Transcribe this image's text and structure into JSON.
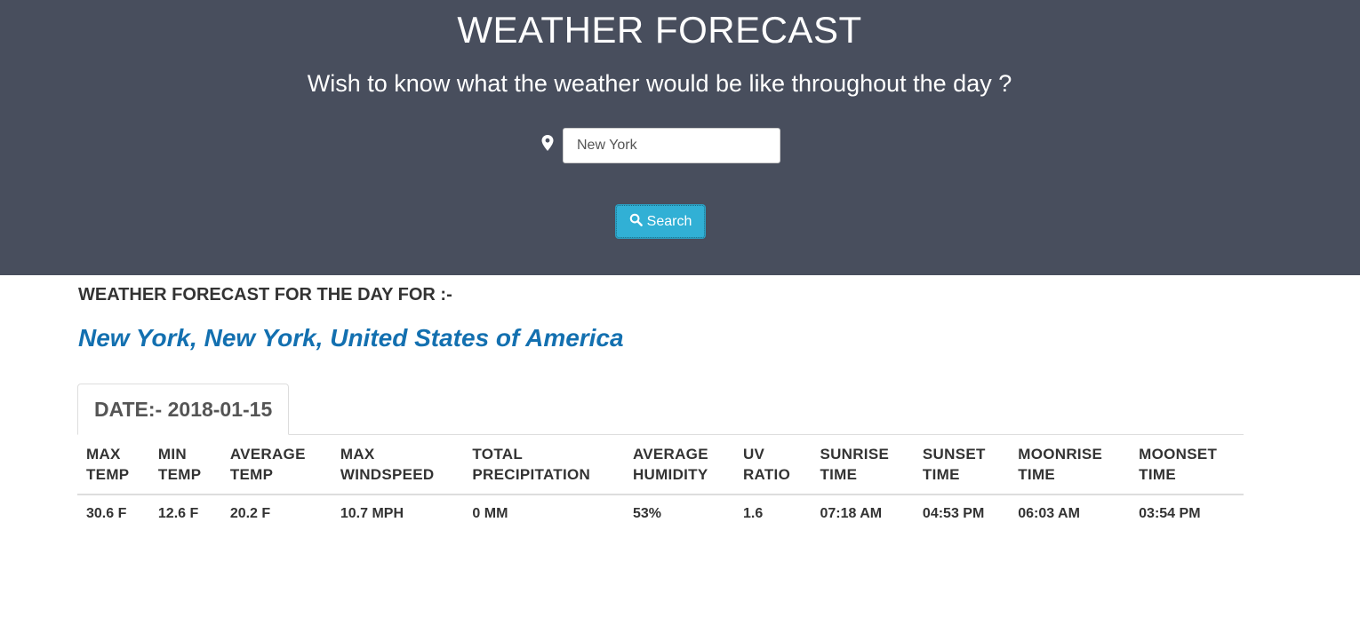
{
  "header": {
    "title": "WEATHER FORECAST",
    "subtitle": "Wish to know what the weather would be like throughout the day ?",
    "location_icon": "map-marker-icon",
    "search_value": "New York",
    "search_button_label": "Search",
    "search_button_icon": "search-icon",
    "background_color": "#484e5d",
    "button_color": "#31b0d5"
  },
  "results": {
    "heading": "WEATHER FORECAST FOR THE DAY FOR :-",
    "location": "New York, New York, United States of America",
    "location_color": "#1370b0",
    "date_tab": "DATE:- 2018-01-15",
    "columns": [
      [
        "MAX",
        "TEMP"
      ],
      [
        "MIN",
        "TEMP"
      ],
      [
        "AVERAGE",
        "TEMP"
      ],
      [
        "MAX",
        "WINDSPEED"
      ],
      [
        "TOTAL",
        "PRECIPITATION"
      ],
      [
        "AVERAGE",
        "HUMIDITY"
      ],
      [
        "UV",
        "RATIO"
      ],
      [
        "SUNRISE",
        "TIME"
      ],
      [
        "SUNSET",
        "TIME"
      ],
      [
        "MOONRISE",
        "TIME"
      ],
      [
        "MOONSET",
        "TIME"
      ]
    ],
    "row": [
      "30.6 F",
      "12.6 F",
      "20.2 F",
      "10.7 MPH",
      "0 MM",
      "53%",
      "1.6",
      "07:18 AM",
      "04:53 PM",
      "06:03 AM",
      "03:54 PM"
    ]
  }
}
